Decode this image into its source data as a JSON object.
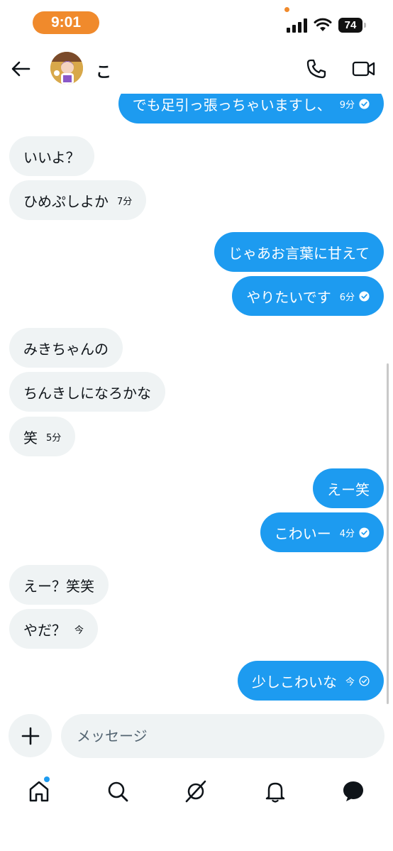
{
  "status_bar": {
    "time": "9:01",
    "battery": "74"
  },
  "header": {
    "contact_name": "こ"
  },
  "messages": [
    {
      "direction": "out",
      "text": "でも足引っ張っちゃいますし、",
      "time": "9分",
      "status": "read"
    },
    {
      "direction": "in",
      "text": "いいよ？",
      "time": ""
    },
    {
      "direction": "in",
      "text": "ひめぷしよか",
      "time": "7分"
    },
    {
      "direction": "out",
      "text": "じゃあお言葉に甘えて",
      "time": ""
    },
    {
      "direction": "out",
      "text": "やりたいです",
      "time": "6分",
      "status": "read"
    },
    {
      "direction": "in",
      "text": "みきちゃんの",
      "time": ""
    },
    {
      "direction": "in",
      "text": "ちんきしになろかな",
      "time": ""
    },
    {
      "direction": "in",
      "text": "笑",
      "time": "5分"
    },
    {
      "direction": "out",
      "text": "えー笑",
      "time": ""
    },
    {
      "direction": "out",
      "text": "こわいー",
      "time": "4分",
      "status": "read"
    },
    {
      "direction": "in",
      "text": "えー？笑笑",
      "time": ""
    },
    {
      "direction": "in",
      "text": "やだ？",
      "time": "今"
    },
    {
      "direction": "out",
      "text": "少しこわいな",
      "time": "今",
      "status": "sent"
    }
  ],
  "composer": {
    "placeholder": "メッセージ"
  },
  "bottom_nav": {
    "items": [
      "home-icon",
      "search-icon",
      "grok-icon",
      "notifications-icon",
      "messages-icon"
    ]
  },
  "colors": {
    "accent": "#1d9bf0",
    "incoming_bubble": "#eff3f4",
    "time_pill": "#f08a2c"
  }
}
